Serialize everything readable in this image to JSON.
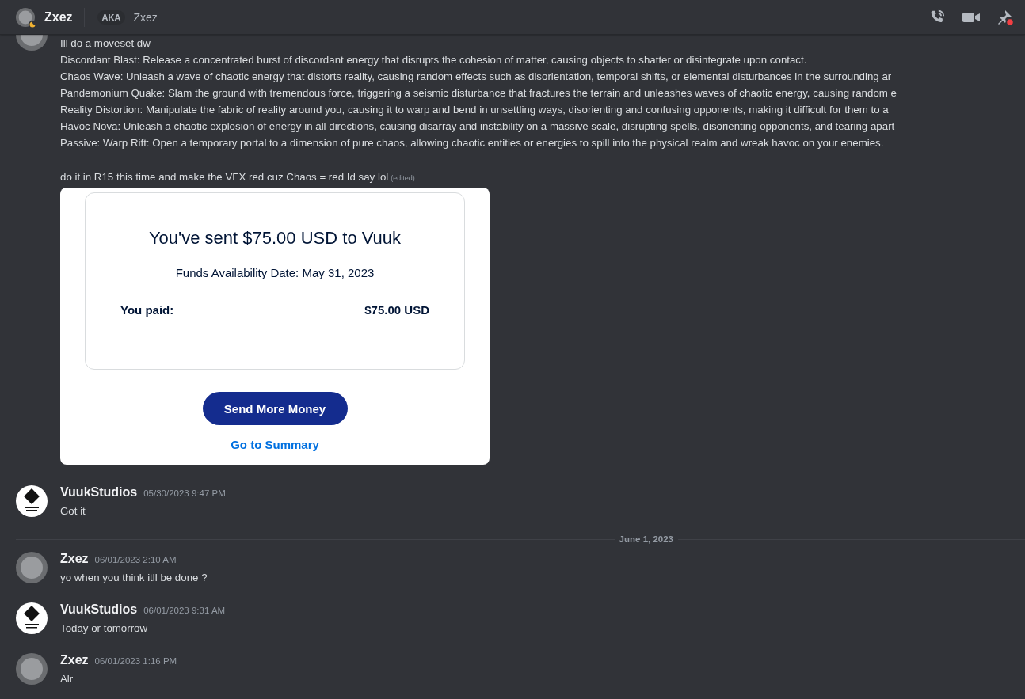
{
  "header": {
    "name": "Zxez",
    "aka_badge": "AKA",
    "aka_name": "Zxez",
    "status": {
      "kind": "idle"
    },
    "pins_unread": true
  },
  "messages": [
    {
      "kind": "continued",
      "avatar": {
        "kind": "photo"
      },
      "paragraphs": [
        {
          "lines": [
            "Ill do a moveset dw",
            "Discordant Blast: Release a concentrated burst of discordant energy that disrupts the cohesion of matter, causing objects to shatter or disintegrate upon contact.",
            "Chaos Wave: Unleash a wave of chaotic energy that distorts reality, causing random effects such as disorientation, temporal shifts, or elemental disturbances in the surrounding ar",
            "Pandemonium Quake: Slam the ground with tremendous force, triggering a seismic disturbance that fractures the terrain and unleashes waves of chaotic energy, causing random e",
            "Reality Distortion: Manipulate the fabric of reality around you, causing it to warp and bend in unsettling ways, disorienting and confusing opponents, making it difficult for them to a",
            "Havoc Nova: Unleash a chaotic explosion of energy in all directions, causing disarray and instability on a massive scale, disrupting spells, disorienting opponents, and tearing apart",
            "Passive: Warp Rift: Open a temporary portal to a dimension of pure chaos, allowing chaotic entities or energies to spill into the physical realm and wreak havoc on your enemies."
          ]
        },
        {
          "lines": [
            "do it in R15 this time and make the VFX red cuz Chaos = red Id say lol"
          ],
          "edited_tag": "(edited)"
        }
      ],
      "embed": {
        "title": "You've sent $75.00 USD to Vuuk",
        "date": "Funds Availability Date: May 31, 2023",
        "paid_label": "You paid:",
        "paid_amount": "$75.00 USD",
        "button": "Send More Money",
        "link": "Go to Summary"
      }
    },
    {
      "kind": "message",
      "avatar": {
        "kind": "logo"
      },
      "author": "VuukStudios",
      "timestamp": "05/30/2023 9:47 PM",
      "paragraphs": [
        {
          "lines": [
            "Got it"
          ]
        }
      ]
    },
    {
      "kind": "divider",
      "label": "June 1, 2023"
    },
    {
      "kind": "message",
      "avatar": {
        "kind": "photo"
      },
      "author": "Zxez",
      "timestamp": "06/01/2023 2:10 AM",
      "paragraphs": [
        {
          "lines": [
            "yo when you think itll be done ?"
          ]
        }
      ]
    },
    {
      "kind": "message",
      "avatar": {
        "kind": "logo"
      },
      "author": "VuukStudios",
      "timestamp": "06/01/2023 9:31 AM",
      "paragraphs": [
        {
          "lines": [
            "Today or tomorrow"
          ]
        }
      ]
    },
    {
      "kind": "message",
      "avatar": {
        "kind": "photo"
      },
      "author": "Zxez",
      "timestamp": "06/01/2023 1:16 PM",
      "paragraphs": [
        {
          "lines": [
            "Alr"
          ]
        }
      ]
    }
  ]
}
